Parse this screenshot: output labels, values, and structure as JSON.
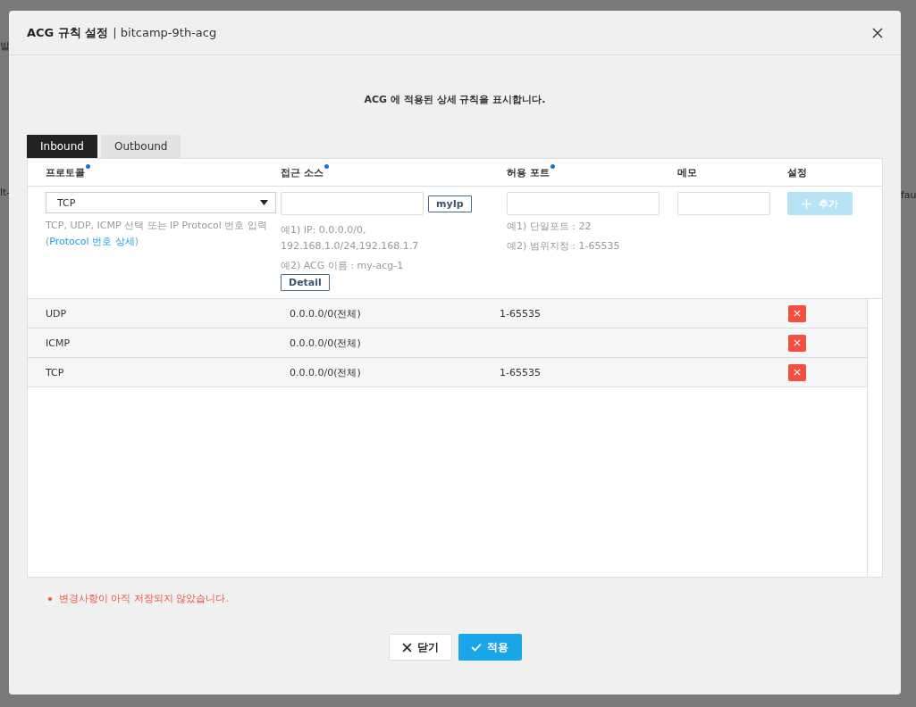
{
  "backdrop": {
    "left_texts": [
      "발",
      "lt-"
    ],
    "right_texts": [
      "fau"
    ]
  },
  "dialog": {
    "title": "ACG 규칙 설정",
    "subtitle": "| bitcamp-9th-acg",
    "description": "ACG 에 적용된 상세 규칙을 표시합니다."
  },
  "tabs": [
    {
      "label": "Inbound",
      "selected": true
    },
    {
      "label": "Outbound",
      "selected": false
    }
  ],
  "columns": [
    {
      "label": "프로토콜",
      "required": true
    },
    {
      "label": "접근 소스",
      "required": true
    },
    {
      "label": "허용 포트",
      "required": true
    },
    {
      "label": "메모",
      "required": false
    },
    {
      "label": "설정",
      "required": false
    }
  ],
  "form": {
    "protocol": "TCP",
    "protocol_hint": "TCP, UDP, ICMP 선택 또는 IP Protocol 번호 입력",
    "protocol_link_open": "(",
    "protocol_link": "Protocol 번호 상세",
    "protocol_link_close": ")",
    "myip_button": "myIp",
    "source_hint1": "예1) IP: 0.0.0.0/0, 192.168.1.0/24,192.168.1.7",
    "source_hint2": "예2) ACG 이름 : my-acg-1",
    "detail_button": "Detail",
    "port_hint1": "예1) 단일포트 : 22",
    "port_hint2": "예2) 범위지정 : 1-65535",
    "add_button": "추가",
    "add_disabled": true
  },
  "rules": [
    {
      "protocol": "UDP",
      "source": "0.0.0.0/0(전체)",
      "port": "1-65535"
    },
    {
      "protocol": "ICMP",
      "source": "0.0.0.0/0(전체)"
    },
    {
      "protocol": "TCP",
      "source": "0.0.0.0/0(전체)",
      "port": "1-65535"
    }
  ],
  "warning": "변경사항이 아직 저장되지 않았습니다.",
  "buttons": [
    {
      "label": "닫기",
      "kind": "close"
    },
    {
      "label": "적용",
      "kind": "apply"
    }
  ]
}
